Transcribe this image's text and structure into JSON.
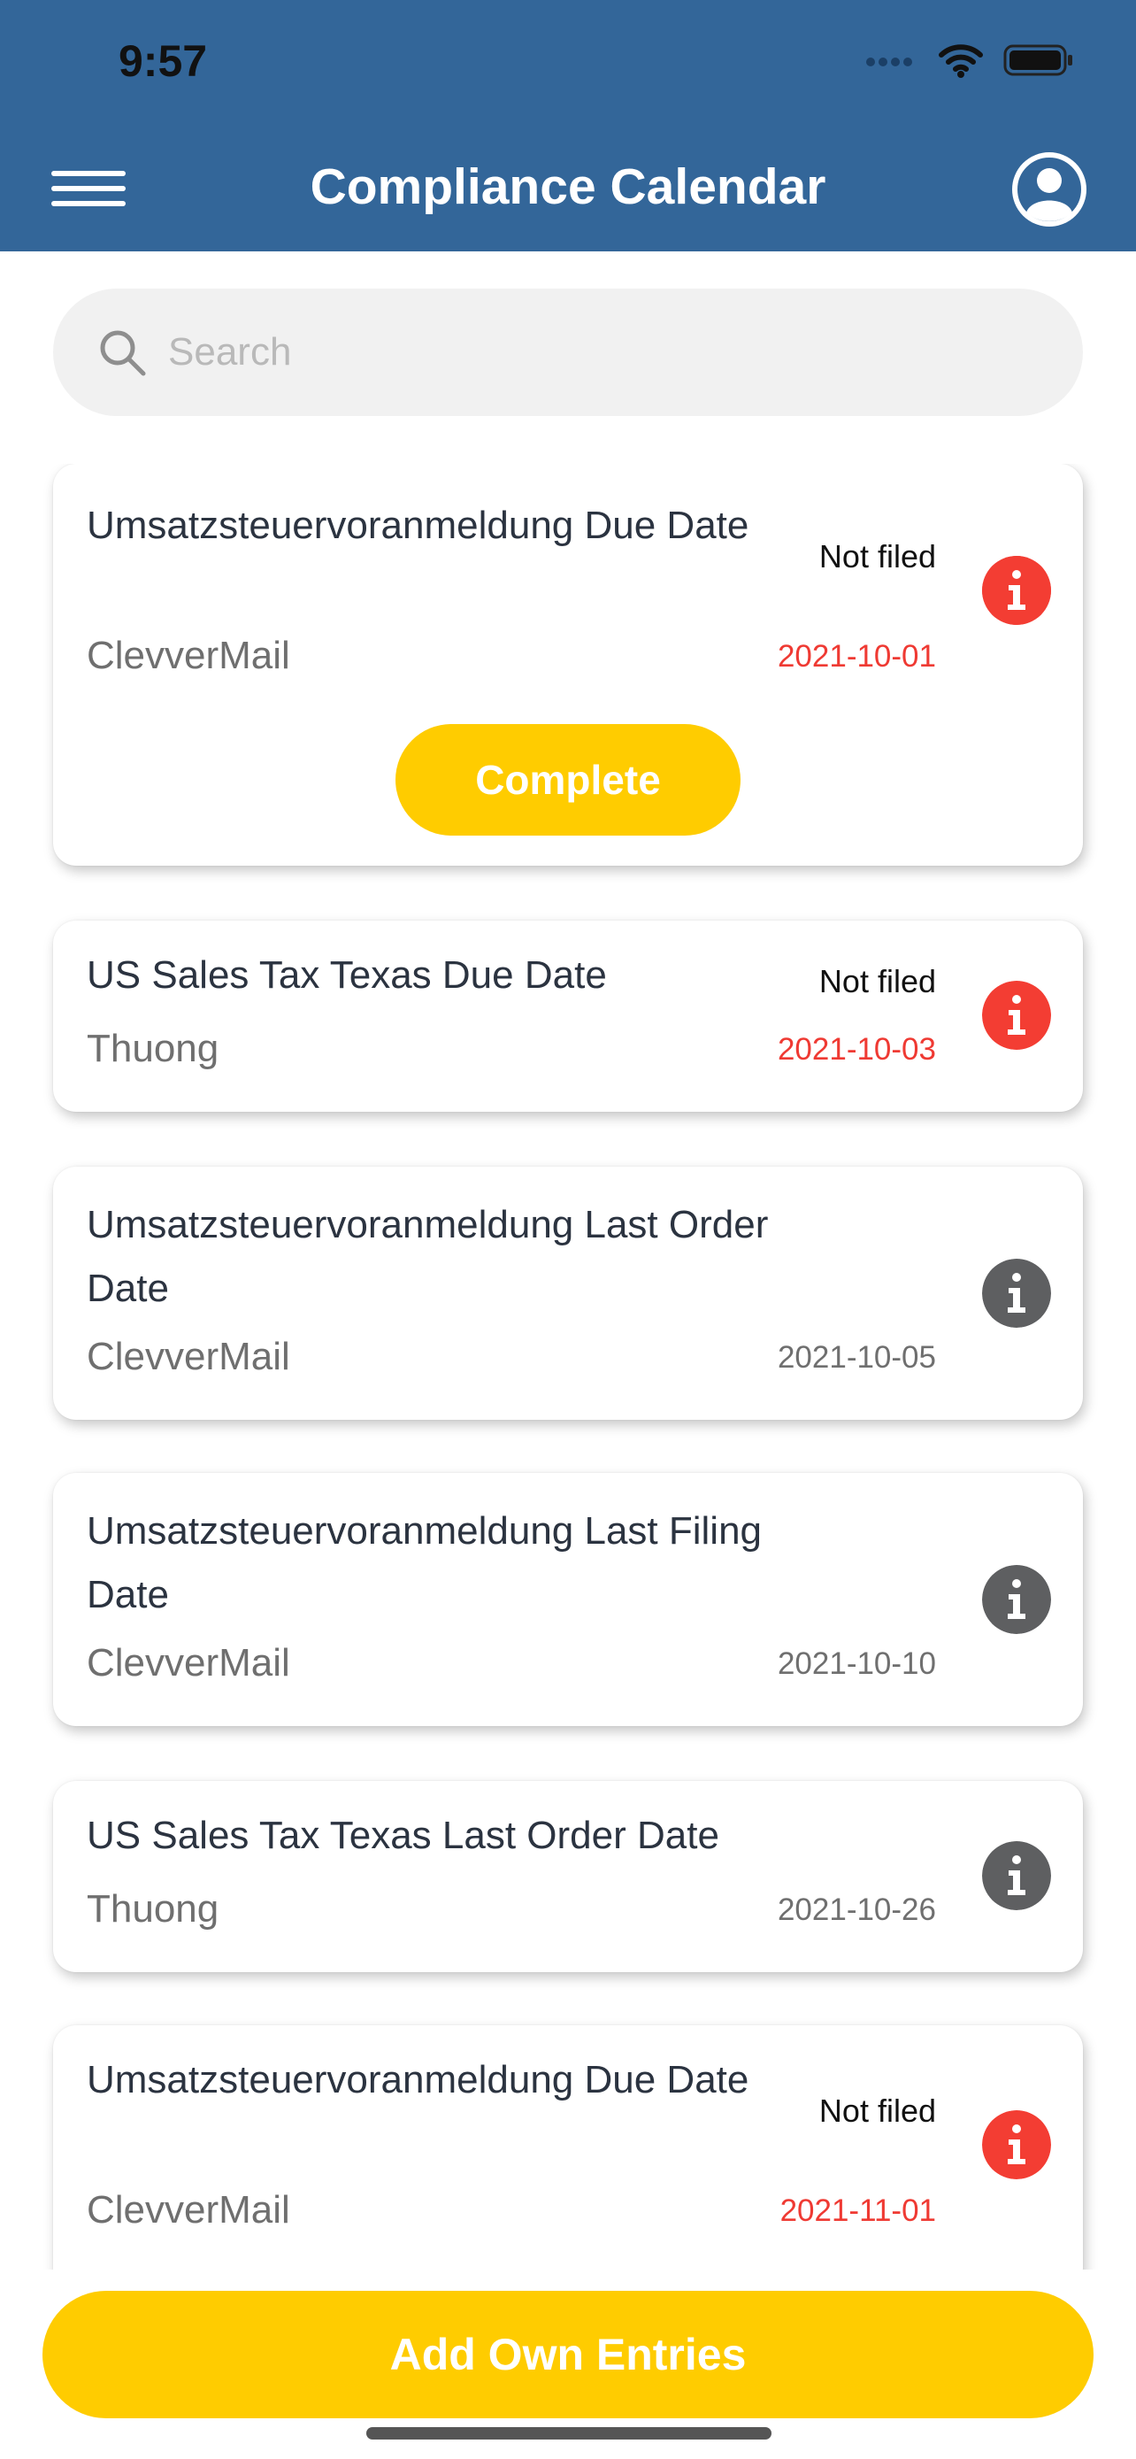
{
  "status_bar": {
    "time": "9:57"
  },
  "header": {
    "title": "Compliance Calendar"
  },
  "search": {
    "placeholder": "Search",
    "value": ""
  },
  "entries": [
    {
      "title": "Umsatzsteuervoranmeldung Due Date",
      "company": "ClevverMail",
      "status": "Not filed",
      "date": "2021-10-01",
      "overdue": true,
      "action": "Complete"
    },
    {
      "title": "US Sales Tax Texas Due Date",
      "company": "Thuong",
      "status": "Not filed",
      "date": "2021-10-03",
      "overdue": true
    },
    {
      "title": "Umsatzsteuervoranmeldung Last Order Date",
      "company": "ClevverMail",
      "status": "",
      "date": "2021-10-05",
      "overdue": false
    },
    {
      "title": "Umsatzsteuervoranmeldung Last Filing Date",
      "company": "ClevverMail",
      "status": "",
      "date": "2021-10-10",
      "overdue": false
    },
    {
      "title": "US Sales Tax Texas Last Order Date",
      "company": "Thuong",
      "status": "",
      "date": "2021-10-26",
      "overdue": false
    },
    {
      "title": "Umsatzsteuervoranmeldung Due Date",
      "company": "ClevverMail",
      "status": "Not filed",
      "date": "2021-11-01",
      "overdue": true
    }
  ],
  "footer": {
    "add_label": "Add Own Entries"
  },
  "colors": {
    "header": "#336699",
    "accent": "#ffcc00",
    "overdue": "#f33d33",
    "neutral": "#5e5f61"
  }
}
